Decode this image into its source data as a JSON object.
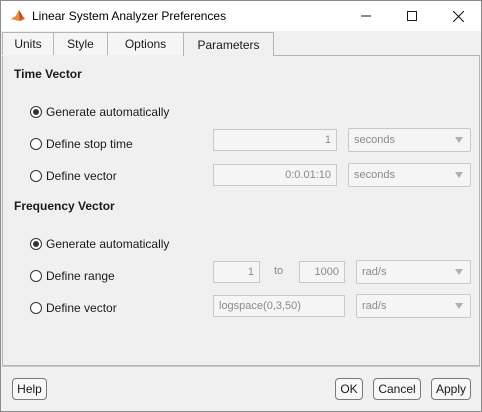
{
  "window": {
    "title": "Linear System Analyzer Preferences",
    "app_icon": "matlab-membrane-icon",
    "controls": [
      "minimize-icon",
      "maximize-icon",
      "close-icon"
    ]
  },
  "tabs": [
    {
      "label": "Units",
      "active": false
    },
    {
      "label": "Style",
      "active": false
    },
    {
      "label": "Options",
      "active": false
    },
    {
      "label": "Parameters",
      "active": true
    }
  ],
  "time_vector": {
    "heading": "Time Vector",
    "generate_auto": {
      "label": "Generate automatically",
      "checked": true
    },
    "stop_time": {
      "label": "Define stop time",
      "checked": false,
      "value": "1",
      "units": "seconds"
    },
    "vector": {
      "label": "Define vector",
      "checked": false,
      "value": "0:0.01:10",
      "units": "seconds"
    }
  },
  "frequency_vector": {
    "heading": "Frequency Vector",
    "generate_auto": {
      "label": "Generate automatically",
      "checked": true
    },
    "range": {
      "label": "Define range",
      "checked": false,
      "from": "1",
      "to_label": "to",
      "to": "1000",
      "units": "rad/s"
    },
    "vector": {
      "label": "Define vector",
      "checked": false,
      "value": "logspace(0,3,50)",
      "units": "rad/s"
    }
  },
  "buttons": {
    "help": "Help",
    "ok": "OK",
    "cancel": "Cancel",
    "apply": "Apply"
  }
}
